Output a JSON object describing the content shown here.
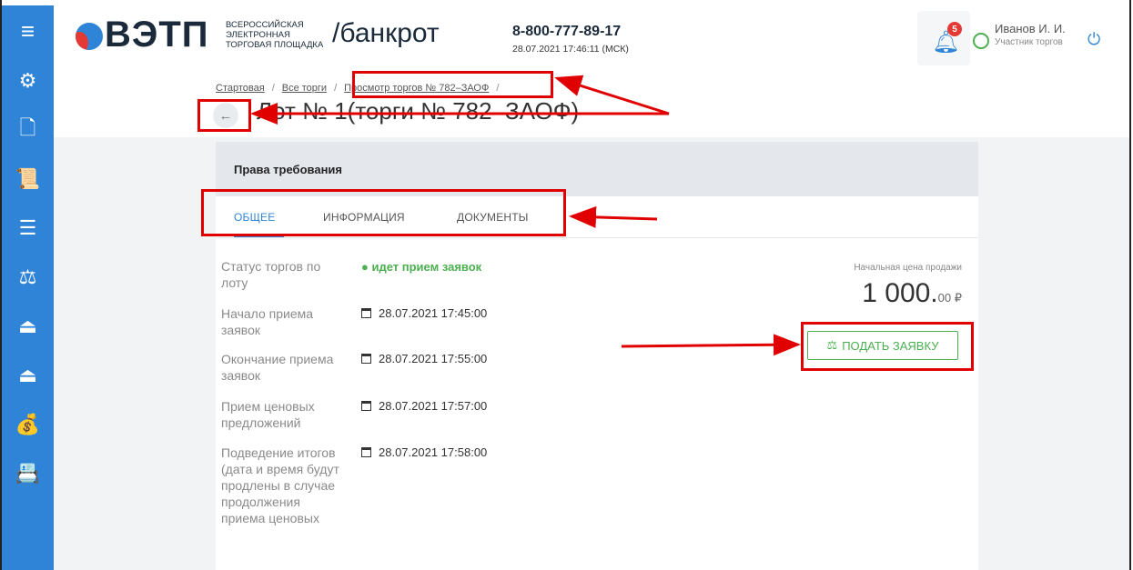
{
  "sidebar": {
    "items": [
      {
        "icon": "menu-icon",
        "glyph": "≡"
      },
      {
        "icon": "settings-icon",
        "glyph": "⚙"
      },
      {
        "icon": "document-icon",
        "glyph": "🗋"
      },
      {
        "icon": "scroll-icon",
        "glyph": "📜"
      },
      {
        "icon": "list-icon",
        "glyph": "☰"
      },
      {
        "icon": "gavel-icon",
        "glyph": "⚖"
      },
      {
        "icon": "upload-icon",
        "glyph": "⏏"
      },
      {
        "icon": "download-icon",
        "glyph": "⏏"
      },
      {
        "icon": "money-bag-icon",
        "glyph": "💰"
      },
      {
        "icon": "contacts-icon",
        "glyph": "📇"
      }
    ]
  },
  "header": {
    "logo_main": "ВЭТП",
    "logo_sub_line1": "ВСЕРОССИЙСКАЯ",
    "logo_sub_line2": "ЭЛЕКТРОННАЯ",
    "logo_sub_line3": "ТОРГОВАЯ ПЛОЩАДКА",
    "logo_path": "/банкрот",
    "phone": "8-800-777-89-17",
    "datetime": "28.07.2021 17:46:11 (МСК)",
    "notifications_count": "5",
    "user_name": "Иванов И. И.",
    "user_role": "Участник торгов"
  },
  "breadcrumb": {
    "items": [
      "Стартовая",
      "Все торги",
      "Просмотр торгов № 782–ЗАОФ"
    ],
    "separator": "/"
  },
  "page": {
    "title": "Лот № 1(торги № 782–ЗАОФ)"
  },
  "card": {
    "title": "Права требования",
    "tabs": [
      "ОБЩЕЕ",
      "ИНФОРМАЦИЯ",
      "ДОКУМЕНТЫ"
    ],
    "active_tab": "ОБЩЕЕ",
    "status_label": "Статус торгов по лоту",
    "status_value": "● идет прием заявок",
    "rows": [
      {
        "label": "Начало приема заявок",
        "value": "28.07.2021 17:45:00"
      },
      {
        "label": "Окончание приема заявок",
        "value": "28.07.2021 17:55:00"
      },
      {
        "label": "Прием ценовых предложений",
        "value": "28.07.2021 17:57:00"
      },
      {
        "label": "Подведение итогов (дата и время будут продлены в случае продолжения приема ценовых",
        "value": "28.07.2021 17:58:00"
      }
    ],
    "price_label": "Начальная цена продажи",
    "price_int": "1 000.",
    "price_frac": "00 ₽",
    "apply_button": "ПОДАТЬ ЗАЯВКУ"
  },
  "colors": {
    "sidebar": "#2f84d8",
    "accent": "#2f84d8",
    "success": "#4caf50",
    "annotation": "#e00000"
  }
}
